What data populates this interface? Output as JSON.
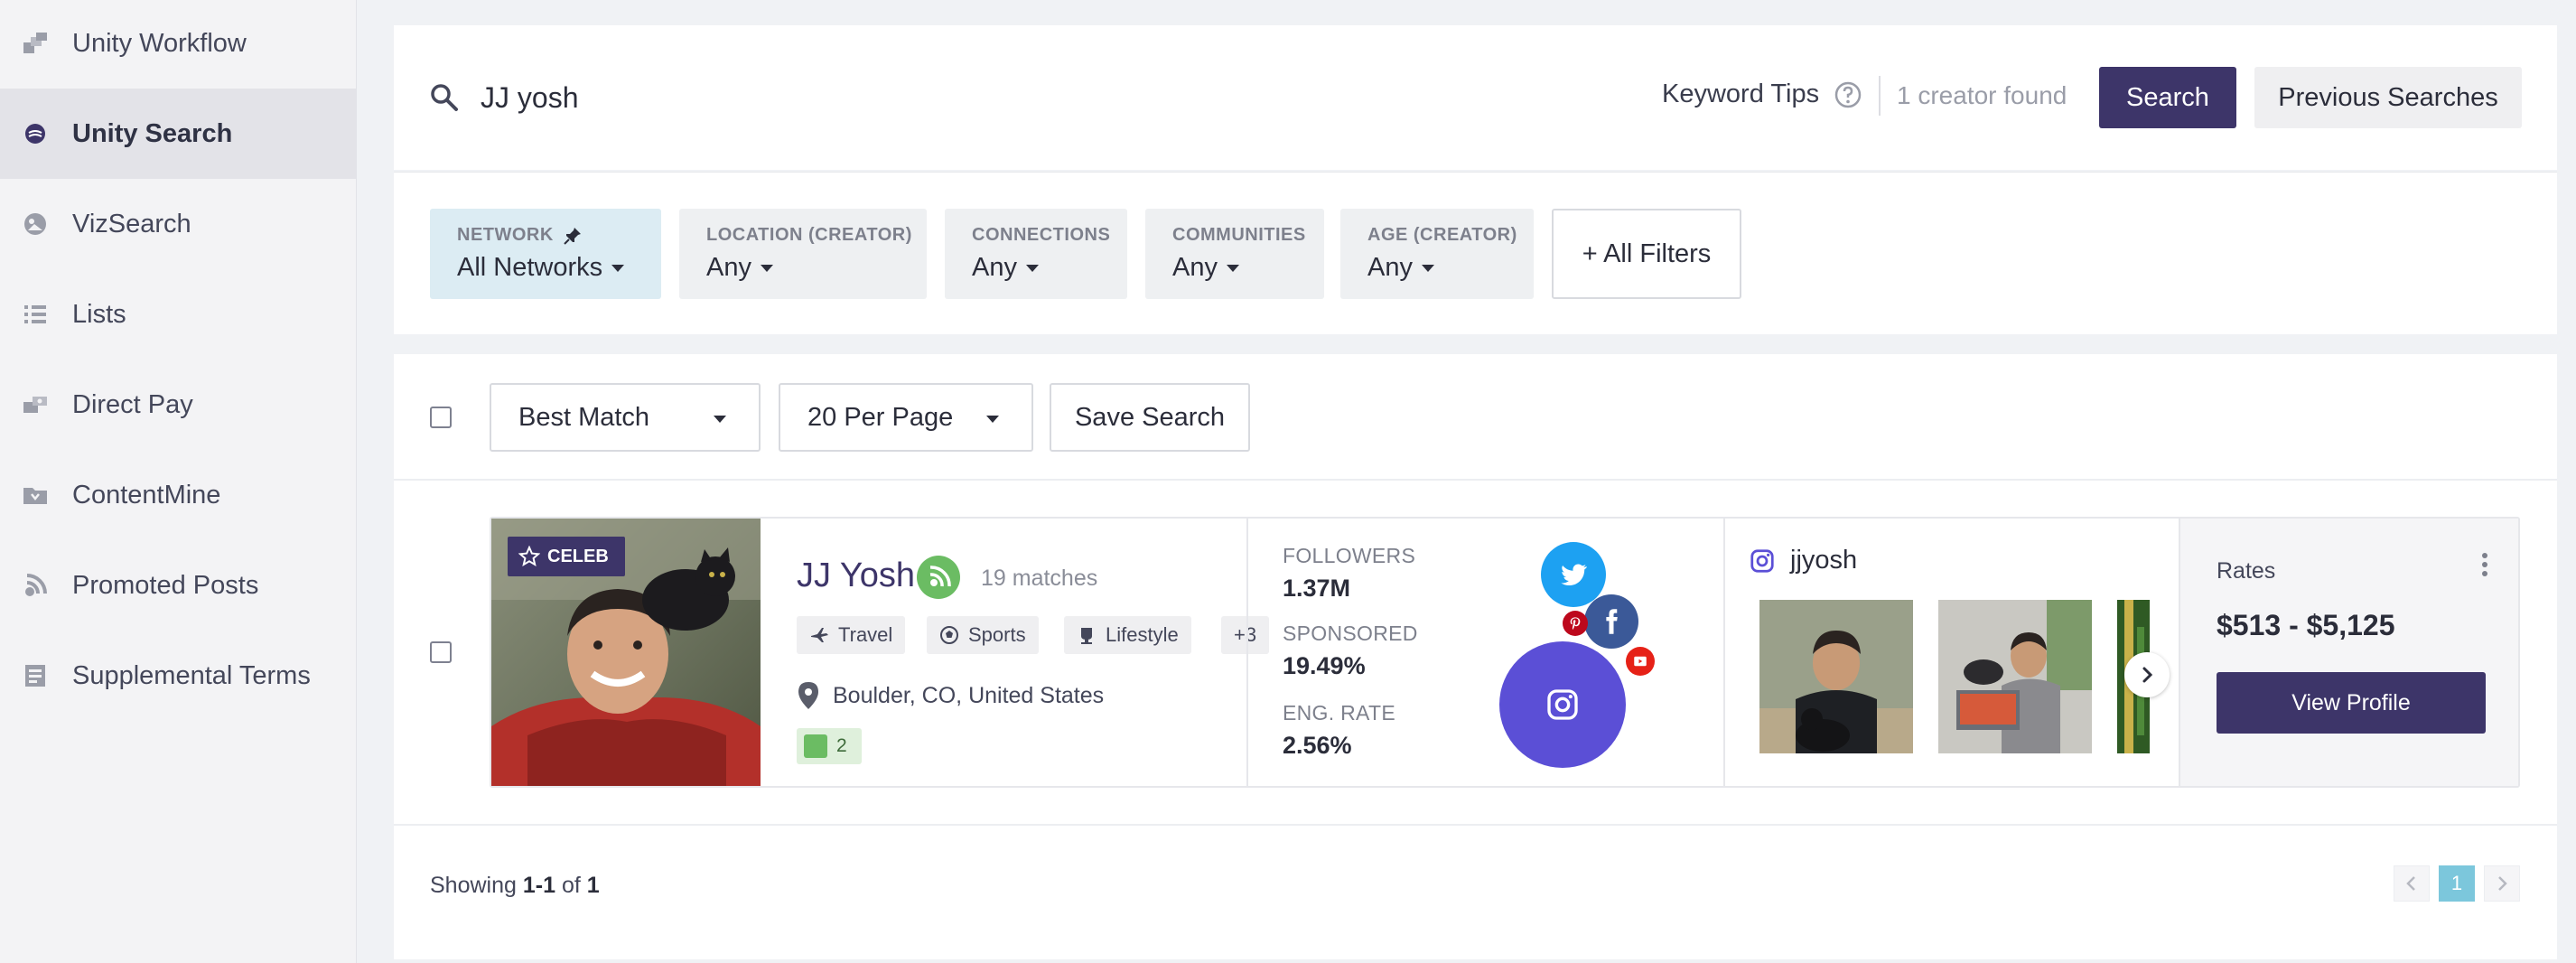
{
  "sidebar": {
    "items": [
      {
        "label": "Unity Workflow",
        "icon": "workflow-icon"
      },
      {
        "label": "Unity Search",
        "icon": "unity-search-icon",
        "active": true
      },
      {
        "label": "VizSearch",
        "icon": "vizsearch-icon"
      },
      {
        "label": "Lists",
        "icon": "list-icon"
      },
      {
        "label": "Direct Pay",
        "icon": "direct-pay-icon"
      },
      {
        "label": "ContentMine",
        "icon": "folder-icon"
      },
      {
        "label": "Promoted Posts",
        "icon": "promoted-posts-icon"
      },
      {
        "label": "Supplemental Terms",
        "icon": "document-icon"
      }
    ]
  },
  "search": {
    "query": "JJ yosh",
    "keyword_tips": "Keyword Tips",
    "found_text": "1 creator found",
    "search_label": "Search",
    "previous_label": "Previous Searches"
  },
  "filters": {
    "network": {
      "label": "NETWORK",
      "value": "All Networks"
    },
    "location": {
      "label": "LOCATION (CREATOR)",
      "value": "Any"
    },
    "connections": {
      "label": "CONNECTIONS",
      "value": "Any"
    },
    "communities": {
      "label": "COMMUNITIES",
      "value": "Any"
    },
    "age": {
      "label": "AGE (CREATOR)",
      "value": "Any"
    },
    "all_filters_label": "+ All Filters"
  },
  "toolbar": {
    "sort_value": "Best Match",
    "per_page_value": "20 Per Page",
    "save_label": "Save Search"
  },
  "creator": {
    "badge": "CELEB",
    "name": "JJ Yosh",
    "matches": "19 matches",
    "tags": [
      "Travel",
      "Sports",
      "Lifestyle",
      "+3"
    ],
    "location": "Boulder, CO, United States",
    "notes_count": "2",
    "stats": {
      "followers_label": "FOLLOWERS",
      "followers_value": "1.37M",
      "sponsored_label": "SPONSORED",
      "sponsored_value": "19.49%",
      "eng_label": "ENG. RATE",
      "eng_value": "2.56%"
    },
    "instagram_handle": "jjyosh",
    "rates_label": "Rates",
    "rates_value": "$513 - $5,125",
    "view_profile_label": "View Profile"
  },
  "pagination": {
    "showing_prefix": "Showing ",
    "showing_range": "1-1",
    "showing_mid": " of ",
    "showing_total": "1",
    "current_page": "1"
  },
  "colors": {
    "primary": "#3d3569",
    "twitter": "#1da1f2",
    "facebook": "#3b5998",
    "pinterest": "#bd081c",
    "youtube": "#e62117",
    "instagram": "#5b4fd6"
  }
}
